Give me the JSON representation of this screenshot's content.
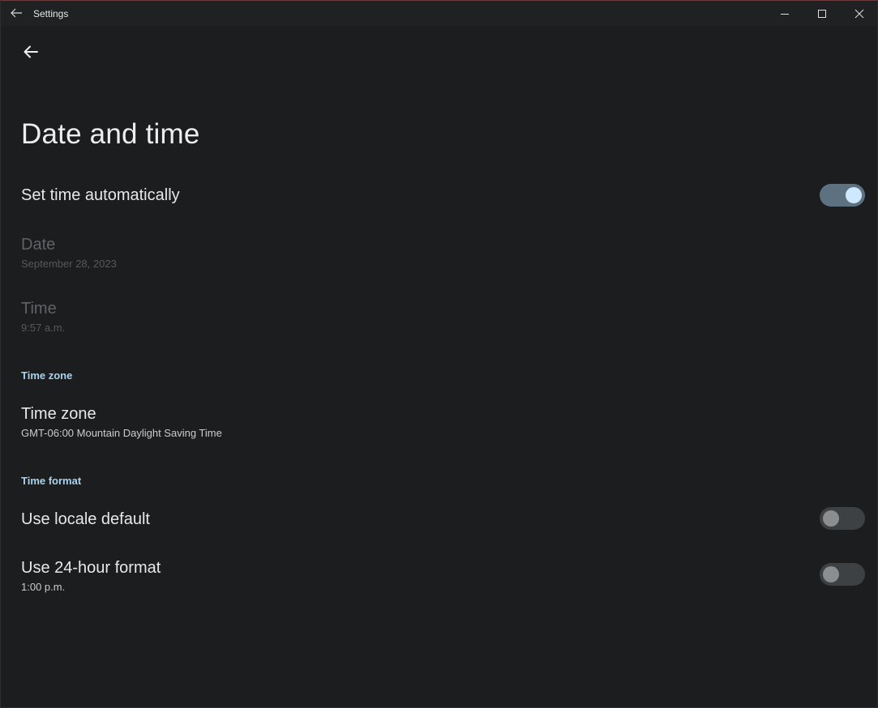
{
  "window": {
    "title": "Settings"
  },
  "page": {
    "title": "Date and time"
  },
  "settings": {
    "set_time_auto": {
      "label": "Set time automatically",
      "enabled": true
    },
    "date": {
      "label": "Date",
      "value": "September 28, 2023"
    },
    "time": {
      "label": "Time",
      "value": "9:57 a.m."
    },
    "time_zone_section": "Time zone",
    "time_zone": {
      "label": "Time zone",
      "value": "GMT-06:00 Mountain Daylight Saving Time"
    },
    "time_format_section": "Time format",
    "use_locale_default": {
      "label": "Use locale default",
      "enabled": false
    },
    "use_24_hour": {
      "label": "Use 24-hour format",
      "value": "1:00 p.m.",
      "enabled": false
    }
  },
  "colors": {
    "background": "#1b1d1f",
    "accent": "#a9d3ee",
    "toggle_on_track": "#5e7180",
    "toggle_on_knob": "#cde8ff"
  },
  "icons": {
    "titlebar_back": "arrow-left-icon",
    "page_back": "arrow-left-icon",
    "minimize": "minimize-icon",
    "maximize": "maximize-icon",
    "close": "close-icon"
  }
}
